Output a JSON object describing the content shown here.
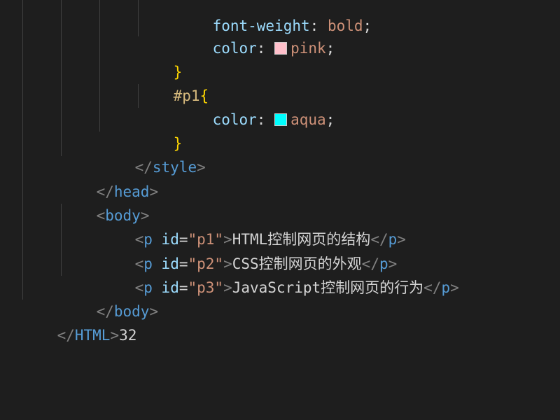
{
  "code": {
    "line1": {
      "prop": "font-weight",
      "colon": ": ",
      "value": "bold",
      "semi": ";"
    },
    "line2": {
      "prop": "color",
      "colon": ": ",
      "swatch_color": "#ffc0cb",
      "value": "pink",
      "semi": ";"
    },
    "line3": {
      "brace": "}"
    },
    "line4": {
      "selector": "#p1",
      "brace": "{"
    },
    "line5": {
      "prop": "color",
      "colon": ": ",
      "swatch_color": "#00ffff",
      "value": "aqua",
      "semi": ";"
    },
    "line6": {
      "brace": "}"
    },
    "line7": {
      "open": "</",
      "tag": "style",
      "close": ">"
    },
    "line8": {
      "open": "</",
      "tag": "head",
      "close": ">"
    },
    "line9": {
      "open": "<",
      "tag": "body",
      "close": ">"
    },
    "line10": {
      "open": "<",
      "tag": "p",
      "attr": "id",
      "eq": "=",
      "val": "\"p1\"",
      "close": ">",
      "text": "HTML控制网页的结构",
      "end_open": "</",
      "end_tag": "p",
      "end_close": ">"
    },
    "line11": {
      "open": "<",
      "tag": "p",
      "attr": "id",
      "eq": "=",
      "val": "\"p2\"",
      "close": ">",
      "text": "CSS控制网页的外观",
      "end_open": "</",
      "end_tag": "p",
      "end_close": ">"
    },
    "line12": {
      "open": "<",
      "tag": "p",
      "attr": "id",
      "eq": "=",
      "val": "\"p3\"",
      "close": ">",
      "text": "JavaScript控制网页的行为",
      "end_open": "</",
      "end_tag": "p",
      "end_close": ">"
    },
    "line13": {
      "open": "</",
      "tag": "body",
      "close": ">"
    },
    "line14": {
      "open": "</",
      "tag": "HTML",
      "close": ">",
      "trailing": "32"
    }
  }
}
